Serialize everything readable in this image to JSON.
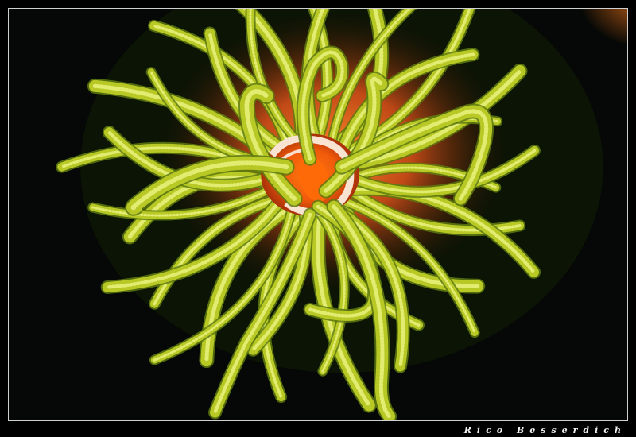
{
  "photo": {
    "subject": "coral-polyp",
    "colors": {
      "background": "#050806",
      "tentacle": "#b8c825",
      "tentacle_dark": "#5e7a10",
      "tentacle_highlight": "#e6f07a",
      "polyp_orange": "#f06a16",
      "polyp_deep": "#c23a0a",
      "mouth_white": "#fff6e8"
    }
  },
  "credit": {
    "text": "Rico Besserdich"
  }
}
